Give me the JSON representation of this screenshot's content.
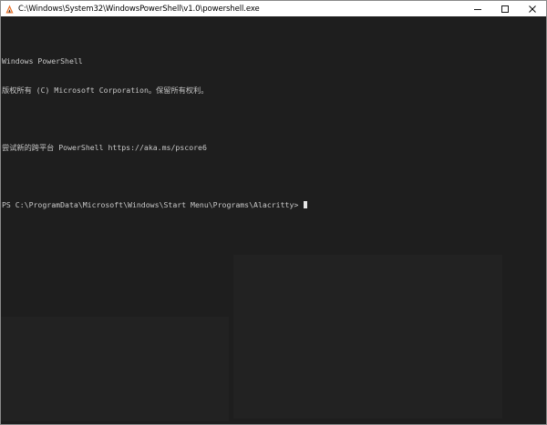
{
  "window": {
    "title": "C:\\Windows\\System32\\WindowsPowerShell\\v1.0\\powershell.exe",
    "app_icon": "alacritty-icon",
    "controls": {
      "minimize": "minimize-icon",
      "maximize": "maximize-icon",
      "close": "close-icon"
    }
  },
  "terminal": {
    "lines": [
      "Windows PowerShell",
      "版权所有 (C) Microsoft Corporation。保留所有权利。",
      "",
      "尝试新的跨平台 PowerShell https://aka.ms/pscore6",
      "",
      "PS C:\\ProgramData\\Microsoft\\Windows\\Start Menu\\Programs\\Alacritty> "
    ],
    "background": "#1e1e1e",
    "foreground": "#c8c8c8"
  }
}
